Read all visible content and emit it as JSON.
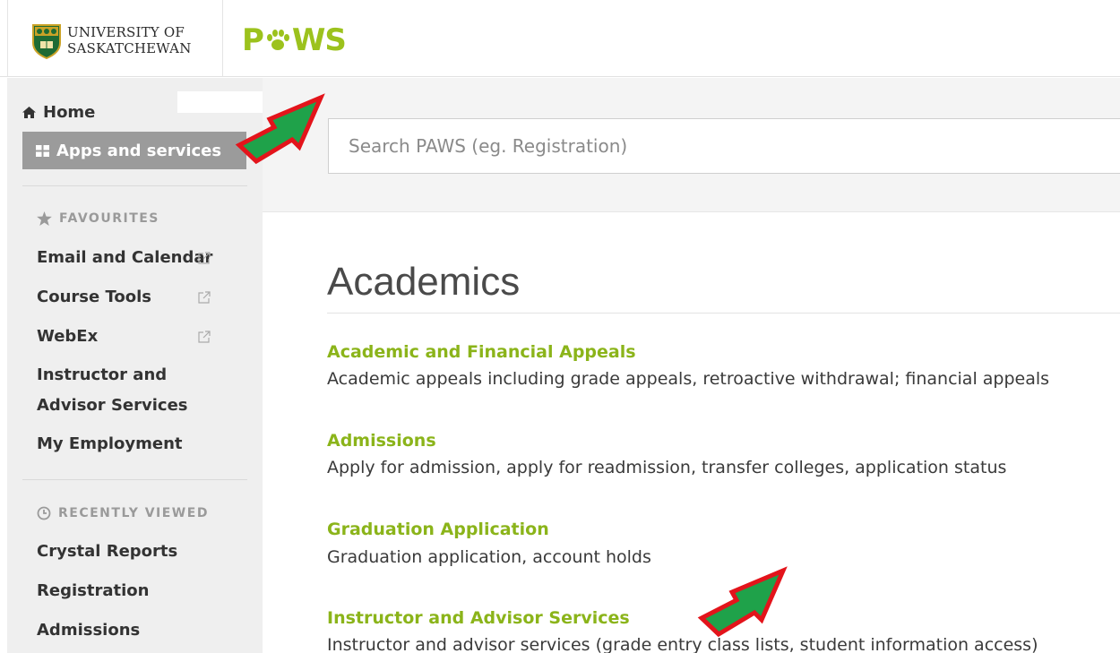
{
  "header": {
    "university_line1": "UNIVERSITY OF",
    "university_line2": "SASKATCHEWAN",
    "app_name_prefix": "P",
    "app_name_suffix": "WS",
    "brand_color": "#9cc21d"
  },
  "sidebar": {
    "home_label": "Home",
    "apps_label": "Apps and services",
    "favourites_title": "FAVOURITES",
    "favourites": [
      {
        "label": "Email and Calendar",
        "external": true
      },
      {
        "label": "Course Tools",
        "external": true
      },
      {
        "label": "WebEx",
        "external": true
      },
      {
        "label_line1": "Instructor and",
        "label_line2": "Advisor Services",
        "external": false
      },
      {
        "label": "My Employment",
        "external": false
      }
    ],
    "recent_title": "RECENTLY VIEWED",
    "recent": [
      {
        "label": "Crystal Reports"
      },
      {
        "label": "Registration"
      },
      {
        "label": "Admissions"
      }
    ]
  },
  "search": {
    "placeholder": "Search PAWS (eg. Registration)"
  },
  "main": {
    "title": "Academics",
    "entries": [
      {
        "title": "Academic and Financial Appeals",
        "desc": "Academic appeals including grade appeals, retroactive withdrawal; financial appeals"
      },
      {
        "title": "Admissions",
        "desc": "Apply for admission, apply for readmission, transfer colleges, application status"
      },
      {
        "title": "Graduation Application",
        "desc": "Graduation application, account holds"
      },
      {
        "title": "Instructor and Advisor Services",
        "desc": "Instructor and advisor services (grade entry class lists, student information access)"
      }
    ]
  },
  "colors": {
    "accent_green": "#8bb41a",
    "sidebar_bg": "#efefef",
    "active_nav_bg": "#9b9b9b",
    "annotation_arrow_fill": "#1fa24a",
    "annotation_arrow_stroke": "#e3141b"
  }
}
